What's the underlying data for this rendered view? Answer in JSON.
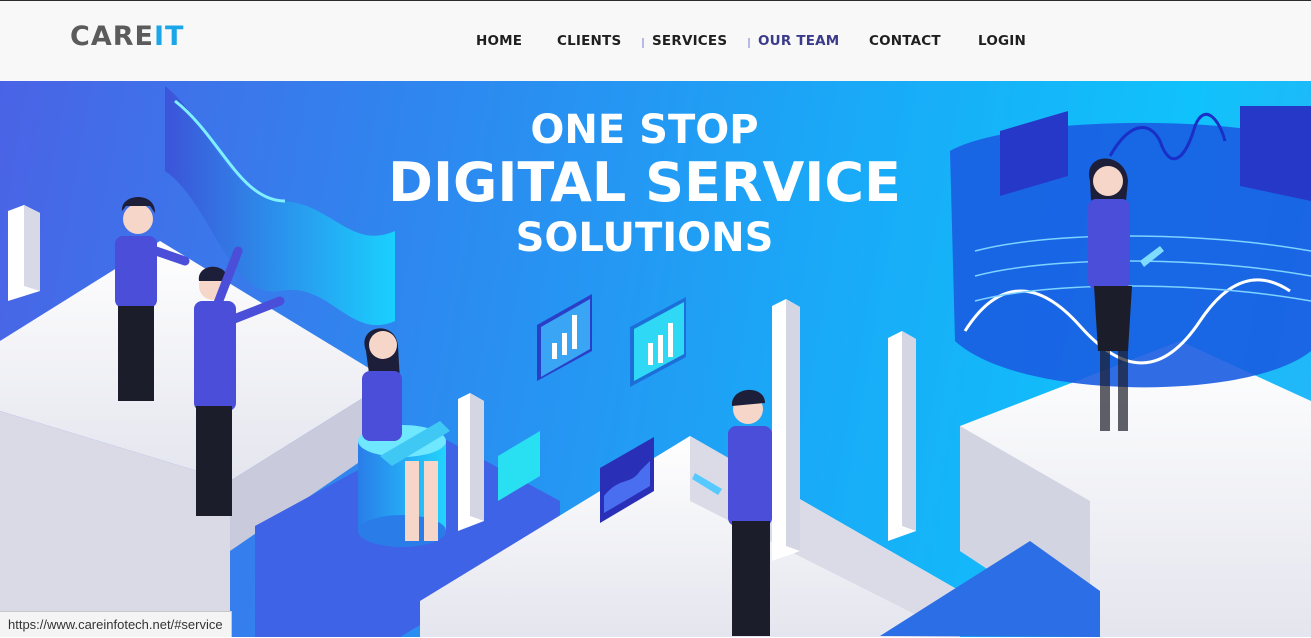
{
  "logo": {
    "part1": "CARE",
    "part2": "IT"
  },
  "nav": {
    "home": "HOME",
    "clients": "CLIENTS",
    "services": "SERVICES",
    "our_team": "OUR TEAM",
    "contact": "CONTACT",
    "login": "LOGIN"
  },
  "hero": {
    "line1": "ONE STOP",
    "line2": "DIGITAL SERVICE",
    "line3": "SOLUTIONS"
  },
  "status_bar": {
    "url": "https://www.careinfotech.net/#service"
  },
  "colors": {
    "brand_gray": "#5b5b5b",
    "brand_blue": "#1aa6e8",
    "hero_start": "#4a63e6",
    "hero_end": "#10c2fb"
  }
}
